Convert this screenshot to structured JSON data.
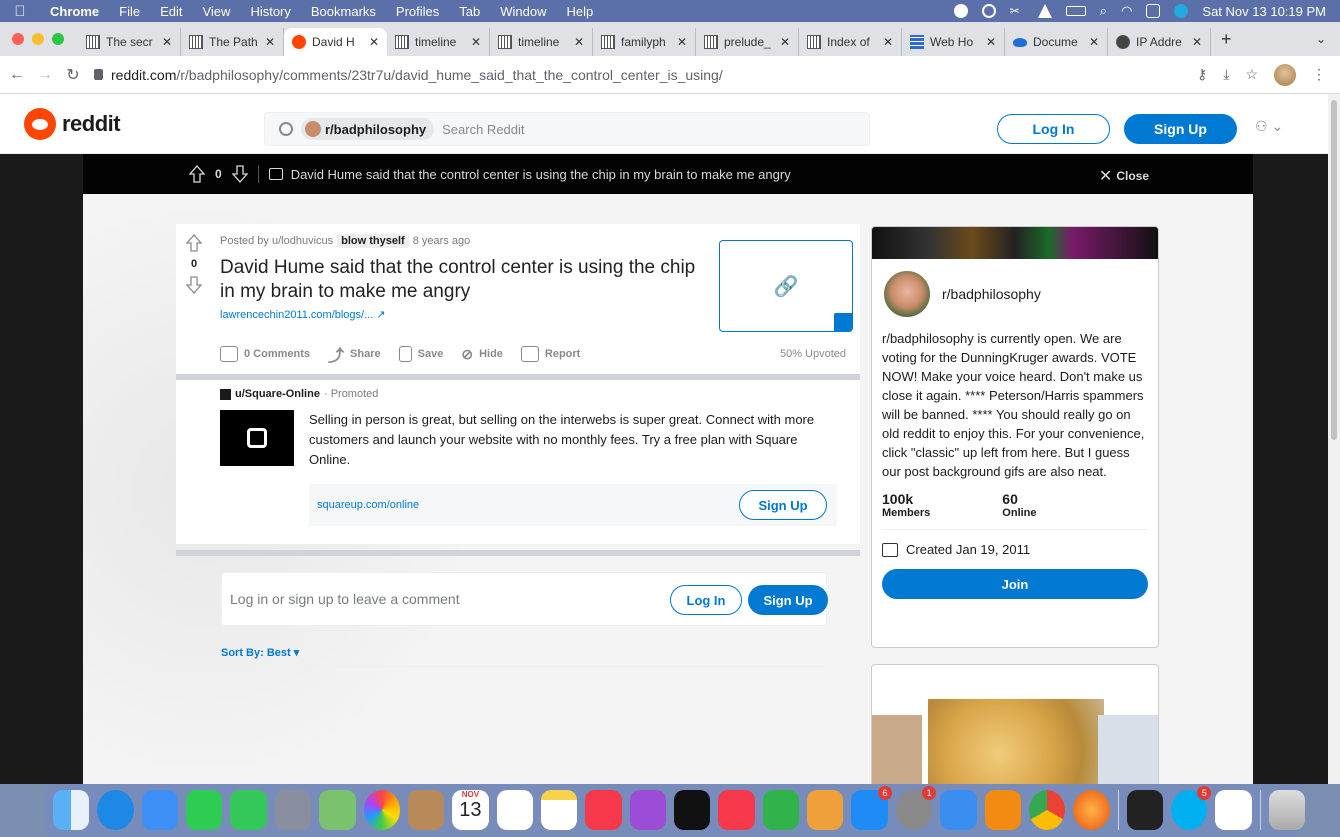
{
  "menubar": {
    "app": "Chrome",
    "items": [
      "File",
      "Edit",
      "View",
      "History",
      "Bookmarks",
      "Profiles",
      "Tab",
      "Window",
      "Help"
    ],
    "datetime": "Sat Nov 13  10:19 PM"
  },
  "tabs": [
    {
      "label": "The secr",
      "icon": "sheet"
    },
    {
      "label": "The Path",
      "icon": "sheet"
    },
    {
      "label": "David H",
      "icon": "reddit",
      "active": true
    },
    {
      "label": "timeline",
      "icon": "sheet"
    },
    {
      "label": "timeline",
      "icon": "sheet"
    },
    {
      "label": "familyph",
      "icon": "sheet"
    },
    {
      "label": "prelude_",
      "icon": "sheet"
    },
    {
      "label": "Index of",
      "icon": "sheet"
    },
    {
      "label": "Web Ho",
      "icon": "grid"
    },
    {
      "label": "Docume",
      "icon": "cloud"
    },
    {
      "label": "IP Addre",
      "icon": "globe"
    }
  ],
  "address": {
    "domain": "reddit.com",
    "path": "/r/badphilosophy/comments/23tr7u/david_hume_said_that_the_control_center_is_using/"
  },
  "header": {
    "logo_text": "reddit",
    "search_chip": "r/badphilosophy",
    "search_placeholder": "Search Reddit",
    "login": "Log In",
    "signup": "Sign Up"
  },
  "postbar": {
    "score": "0",
    "title": "David Hume said that the control center is using the chip in my brain to make me angry",
    "close": "Close"
  },
  "post": {
    "score": "0",
    "posted_by": "Posted by u/lodhuvicus",
    "flair": "blow thyself",
    "age": "8 years ago",
    "title": "David Hume said that the control center is using the chip in my brain to make me angry",
    "link": "lawrencechin2011.com/blogs/...",
    "actions": {
      "comments": "0 Comments",
      "share": "Share",
      "save": "Save",
      "hide": "Hide",
      "report": "Report"
    },
    "upvoted": "50% Upvoted"
  },
  "promo": {
    "author": "u/Square-Online",
    "tag": "· Promoted",
    "text": "Selling in person is great, but selling on the interwebs is super great. Connect with more customers and launch your website with no monthly fees. Try a free plan with Square Online.",
    "cta_url": "squareup.com/online",
    "cta_button": "Sign Up"
  },
  "comment": {
    "placeholder": "Log in or sign up to leave a comment",
    "login": "Log In",
    "signup": "Sign Up",
    "sort": "Sort By: Best"
  },
  "sidebar": {
    "name": "r/badphilosophy",
    "description": "r/badphilosophy is currently open. We are voting for the DunningKruger awards. VOTE NOW! Make your voice heard. Don't make us close it again. **** Peterson/Harris spammers will be banned. **** You should really go on old reddit to enjoy this. For your convenience, click \"classic\" up left from here. But I guess our post background gifs are also neat.",
    "members_count": "100k",
    "members_label": "Members",
    "online_count": "60",
    "online_label": "Online",
    "created": "Created Jan 19, 2011",
    "join": "Join"
  },
  "dock": {
    "calendar_month": "NOV",
    "calendar_day": "13",
    "badges": {
      "appstore": "6",
      "prefs": "1",
      "skype": "5"
    }
  },
  "colors": {
    "reddit_orange": "#ff4500",
    "reddit_blue": "#0079d3"
  }
}
